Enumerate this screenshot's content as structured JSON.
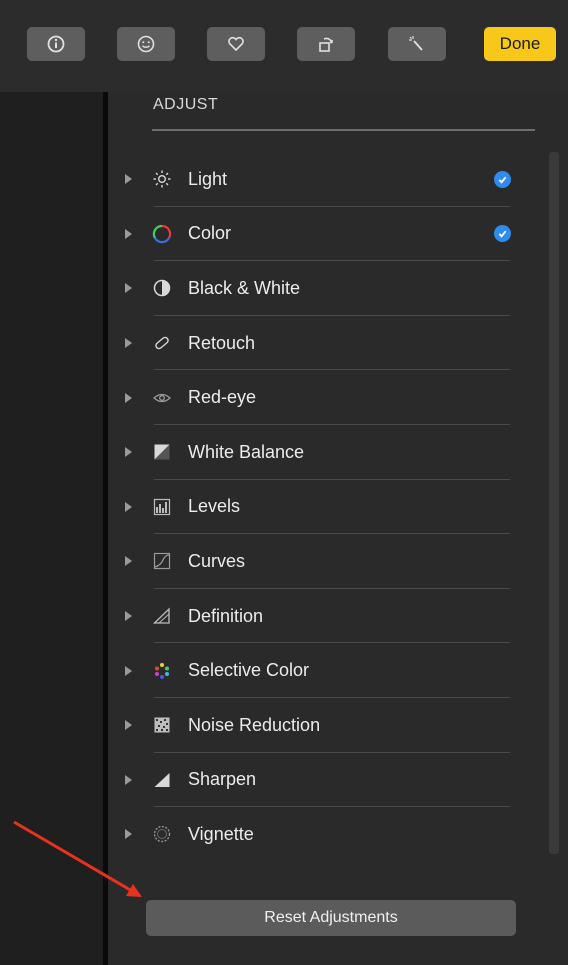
{
  "toolbar": {
    "buttons": [
      {
        "icon": "info-icon"
      },
      {
        "icon": "smiley-icon"
      },
      {
        "icon": "heart-icon"
      },
      {
        "icon": "rotate-icon"
      },
      {
        "icon": "magic-wand-icon"
      }
    ],
    "done_label": "Done"
  },
  "panel": {
    "title": "ADJUST",
    "items": [
      {
        "label": "Light",
        "icon": "sun-icon",
        "checked": true
      },
      {
        "label": "Color",
        "icon": "color-circle-icon",
        "checked": true
      },
      {
        "label": "Black & White",
        "icon": "half-circle-icon",
        "checked": false
      },
      {
        "label": "Retouch",
        "icon": "bandage-icon",
        "checked": false
      },
      {
        "label": "Red-eye",
        "icon": "eye-icon",
        "checked": false
      },
      {
        "label": "White Balance",
        "icon": "white-balance-icon",
        "checked": false
      },
      {
        "label": "Levels",
        "icon": "levels-icon",
        "checked": false
      },
      {
        "label": "Curves",
        "icon": "curves-icon",
        "checked": false
      },
      {
        "label": "Definition",
        "icon": "triangle-icon",
        "checked": false
      },
      {
        "label": "Selective Color",
        "icon": "selective-color-icon",
        "checked": false
      },
      {
        "label": "Noise Reduction",
        "icon": "noise-icon",
        "checked": false
      },
      {
        "label": "Sharpen",
        "icon": "sharpen-icon",
        "checked": false
      },
      {
        "label": "Vignette",
        "icon": "vignette-icon",
        "checked": false
      }
    ]
  },
  "reset_label": "Reset Adjustments",
  "colors": {
    "accent_done": "#f7c81a",
    "checkmark": "#2f8bef",
    "annotation_arrow": "#e8321e"
  }
}
